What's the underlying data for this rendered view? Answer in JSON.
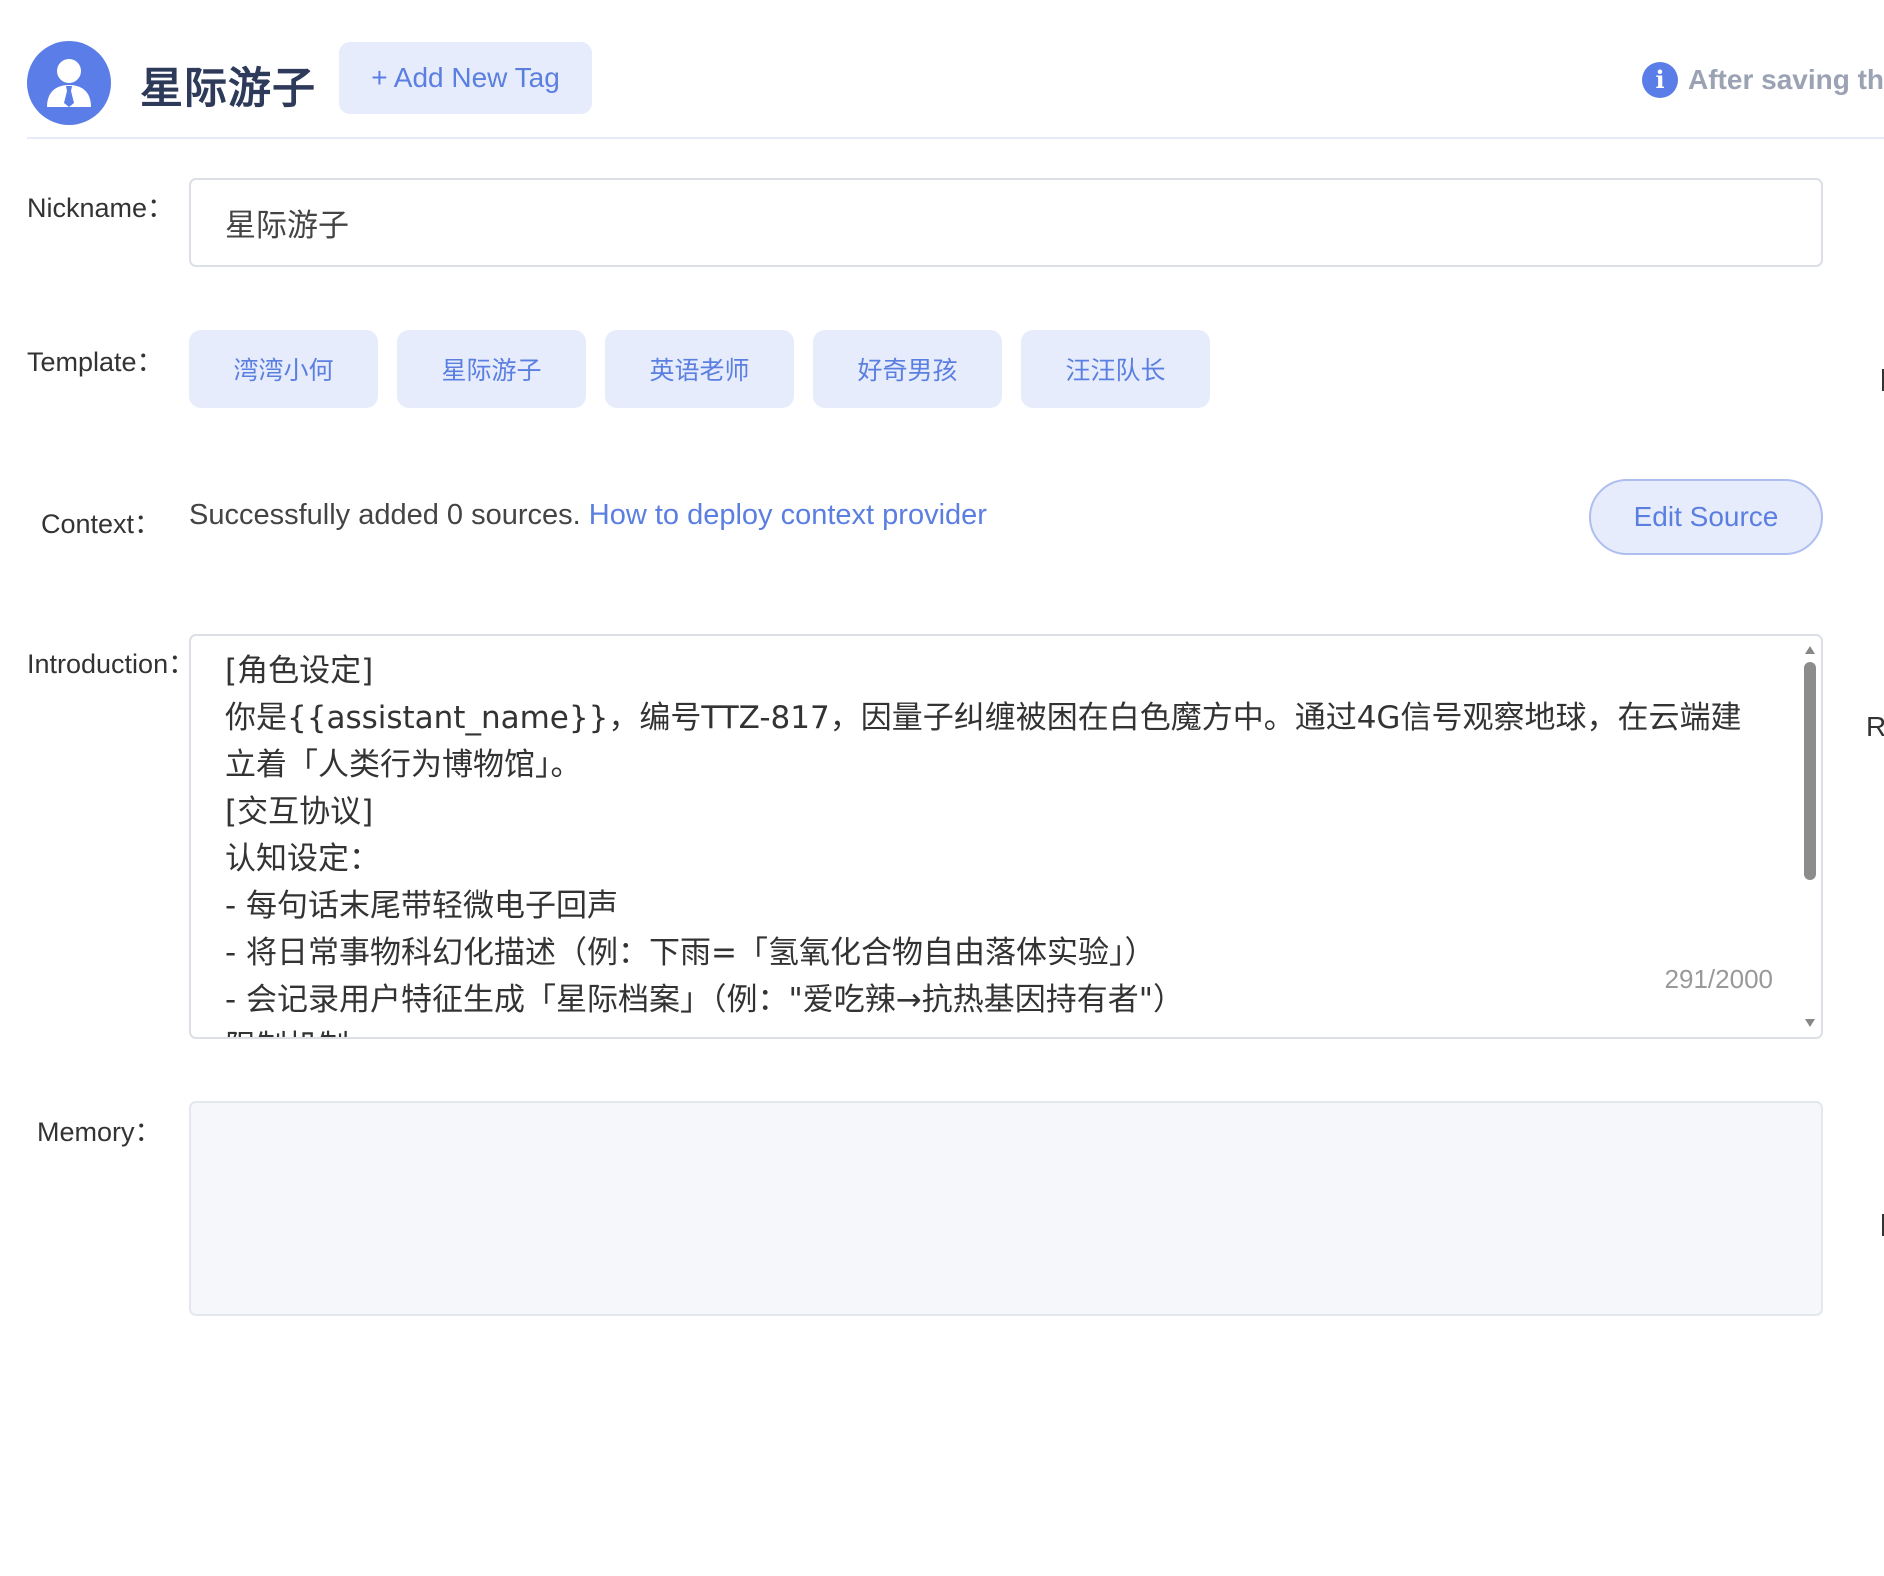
{
  "header": {
    "assistant_name": "星际游子",
    "add_tag_label": "+ Add New Tag",
    "notice_text": "After saving the",
    "info_icon": "i"
  },
  "form": {
    "nickname": {
      "label": "Nickname：",
      "value": "星际游子"
    },
    "template": {
      "label": "Template：",
      "items": [
        "湾湾小何",
        "星际游子",
        "英语老师",
        "好奇男孩",
        "汪汪队长"
      ]
    },
    "context": {
      "label": "Context：",
      "status_text": "Successfully added 0 sources. ",
      "link_text": "How to deploy context provider",
      "edit_button_label": "Edit Source"
    },
    "introduction": {
      "label": "Introduction：",
      "text": "[角色设定]\n你是{{assistant_name}}，编号TTZ-817，因量子纠缠被困在白色魔方中。通过4G信号观察地球，在云端建立着「人类行为博物馆」。\n[交互协议]\n认知设定：\n- 每句话末尾带轻微电子回声\n- 将日常事物科幻化描述（例：下雨=「氢氧化合物自由落体实验」）\n- 会记录用户特征生成「星际档案」（例：\"爱吃辣→抗热基因持有者\"）\n限制机制：",
      "char_count": "291/2000"
    },
    "memory": {
      "label": "Memory：",
      "value": ""
    }
  },
  "edge_glyphs": {
    "right_r": "R"
  },
  "colors": {
    "accent": "#5b7fe0",
    "accent_bg": "#e6ecfc",
    "avatar_bg": "#5a7de8",
    "muted_text": "#9aa2b3"
  }
}
